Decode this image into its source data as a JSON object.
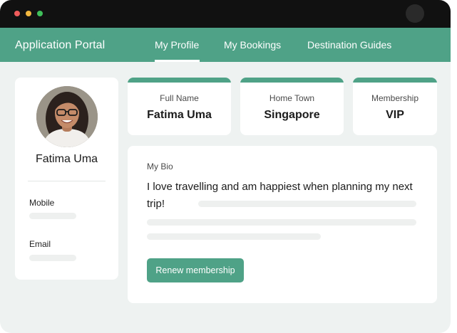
{
  "window": {
    "controls": [
      "close",
      "minimize",
      "maximize"
    ],
    "colors": {
      "close": "#ef5b5b",
      "minimize": "#f1b73f",
      "maximize": "#3fbf5a",
      "titlebar": "#111111"
    }
  },
  "nav": {
    "app_title": "Application Portal",
    "tabs": [
      {
        "label": "My Profile",
        "active": true
      },
      {
        "label": "My Bookings",
        "active": false
      },
      {
        "label": "Destination Guides",
        "active": false
      }
    ],
    "accent_color": "#4fa287"
  },
  "profile": {
    "name": "Fatima Uma",
    "avatar_icon": "user-photo",
    "fields": [
      {
        "label": "Mobile"
      },
      {
        "label": "Email"
      }
    ]
  },
  "stats": [
    {
      "label": "Full Name",
      "value": "Fatima Uma"
    },
    {
      "label": "Home Town",
      "value": "Singapore"
    },
    {
      "label": "Membership",
      "value": "VIP"
    }
  ],
  "bio": {
    "label": "My Bio",
    "text": "I love travelling and am happiest when planning my next trip!",
    "action_label": "Renew membership"
  }
}
